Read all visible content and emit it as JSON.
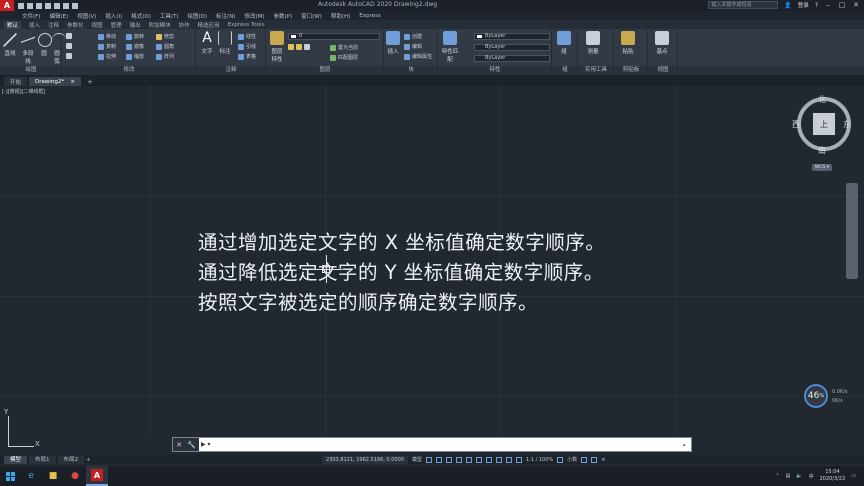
{
  "window": {
    "app_logo": "A",
    "title": "Autodesk AutoCAD 2020   Drawing2.dwg",
    "search_placeholder": "键入关键字或短语",
    "user": "登录"
  },
  "menu": [
    "文件(F)",
    "编辑(E)",
    "视图(V)",
    "插入(I)",
    "格式(O)",
    "工具(T)",
    "绘图(D)",
    "标注(N)",
    "修改(M)",
    "参数(P)",
    "窗口(W)",
    "帮助(H)",
    "Express"
  ],
  "ribbon_tabs": [
    "默认",
    "插入",
    "注释",
    "参数化",
    "视图",
    "管理",
    "输出",
    "附加模块",
    "协作",
    "精选应用",
    "Express Tools"
  ],
  "ribbon_panels": {
    "draw": {
      "title": "绘图",
      "tools": [
        "直线",
        "多段线",
        "圆",
        "圆弧"
      ]
    },
    "modify": {
      "title": "修改",
      "tools": [
        "移动",
        "旋转",
        "修剪",
        "复制",
        "镜像",
        "圆角",
        "拉伸",
        "缩放",
        "阵列"
      ]
    },
    "annotation": {
      "title": "注释",
      "tools": [
        "文字",
        "标注",
        "线性",
        "引线",
        "表格"
      ]
    },
    "layers": {
      "title": "图层",
      "layer_value": "0",
      "tools": [
        "图层特性",
        "置为当前",
        "匹配图层"
      ]
    },
    "block": {
      "title": "块",
      "tools": [
        "插入",
        "创建",
        "编辑",
        "编辑属性"
      ]
    },
    "properties": {
      "title": "特性",
      "tools": [
        "特性匹配"
      ],
      "color": "ByLayer",
      "linetype": "ByLayer",
      "lineweight": "ByLayer"
    },
    "groups": {
      "title": "组",
      "tools": [
        "组"
      ]
    },
    "utilities": {
      "title": "实用工具",
      "tools": [
        "测量"
      ]
    },
    "clipboard": {
      "title": "剪贴板",
      "tools": [
        "粘贴"
      ]
    },
    "view": {
      "title": "视图",
      "tools": [
        "基点"
      ]
    }
  },
  "doc_tabs": {
    "start": "开始",
    "drawing": "Drawing2*",
    "close": "×",
    "add": "+"
  },
  "viewport_label": "[-][俯视][二维线框]",
  "drawing_text": [
    "通过增加选定文字的 X 坐标值确定数字顺序。",
    "通过降低选定文字的 Y 坐标值确定数字顺序。",
    "按照文字被选定的顺序确定数字顺序。"
  ],
  "viewcube": {
    "face": "上",
    "north": "北",
    "south": "南",
    "east": "东",
    "west": "西",
    "wcs": "WCS ▾"
  },
  "zoom": {
    "value": "46",
    "unit": "%",
    "up": "0.0K/s",
    "down": "0K/s"
  },
  "ucs": {
    "x": "X",
    "y": "Y"
  },
  "command_line": {
    "prompt": "▶ ▾",
    "placeholder": ""
  },
  "layout_tabs": [
    "模型",
    "布局1",
    "布局2",
    "+"
  ],
  "status": {
    "coords": "2303.8121, 1962.5186, 0.0000",
    "model": "模型",
    "scale": "1:1 / 100%",
    "units": "小数"
  },
  "taskbar": {
    "time": "15:04",
    "date": "2020/3/22",
    "lang": "中"
  },
  "colors": {
    "canvas": "#212830",
    "ribbon": "#323a46",
    "autocad_red": "#c8201e",
    "accent_blue": "#4e8bd0"
  }
}
